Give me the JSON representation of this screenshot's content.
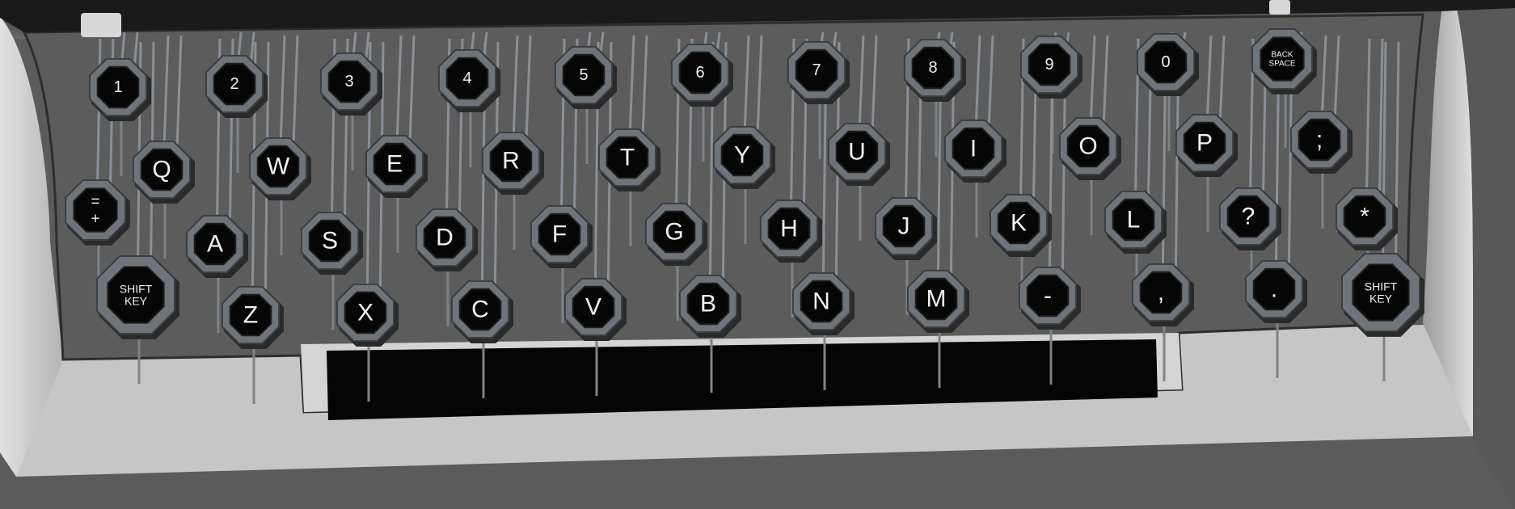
{
  "keyboard": {
    "keys": [
      {
        "id": "1",
        "label": "1"
      },
      {
        "id": "2",
        "label": "2"
      },
      {
        "id": "3",
        "label": "3"
      },
      {
        "id": "4",
        "label": "4"
      },
      {
        "id": "5",
        "label": "5"
      },
      {
        "id": "6",
        "label": "6"
      },
      {
        "id": "7",
        "label": "7"
      },
      {
        "id": "8",
        "label": "8"
      },
      {
        "id": "9",
        "label": "9"
      },
      {
        "id": "0",
        "label": "0"
      },
      {
        "id": "backspace",
        "label": "BACK\nSPACE"
      },
      {
        "id": "q",
        "label": "Q"
      },
      {
        "id": "w",
        "label": "W"
      },
      {
        "id": "e",
        "label": "E"
      },
      {
        "id": "r",
        "label": "R"
      },
      {
        "id": "t",
        "label": "T"
      },
      {
        "id": "y",
        "label": "Y"
      },
      {
        "id": "u",
        "label": "U"
      },
      {
        "id": "i",
        "label": "I"
      },
      {
        "id": "o",
        "label": "O"
      },
      {
        "id": "p",
        "label": "P"
      },
      {
        "id": "semicolon",
        "label": ";"
      },
      {
        "id": "equals-plus",
        "label": "=\n+"
      },
      {
        "id": "a",
        "label": "A"
      },
      {
        "id": "s",
        "label": "S"
      },
      {
        "id": "d",
        "label": "D"
      },
      {
        "id": "f",
        "label": "F"
      },
      {
        "id": "g",
        "label": "G"
      },
      {
        "id": "h",
        "label": "H"
      },
      {
        "id": "j",
        "label": "J"
      },
      {
        "id": "k",
        "label": "K"
      },
      {
        "id": "l",
        "label": "L"
      },
      {
        "id": "question",
        "label": "?"
      },
      {
        "id": "asterisk",
        "label": "*"
      },
      {
        "id": "shift-left",
        "label": "SHIFT\nKEY"
      },
      {
        "id": "z",
        "label": "Z"
      },
      {
        "id": "x",
        "label": "X"
      },
      {
        "id": "c",
        "label": "C"
      },
      {
        "id": "v",
        "label": "V"
      },
      {
        "id": "b",
        "label": "B"
      },
      {
        "id": "n",
        "label": "N"
      },
      {
        "id": "m",
        "label": "M"
      },
      {
        "id": "hyphen",
        "label": "-"
      },
      {
        "id": "comma",
        "label": ","
      },
      {
        "id": "period",
        "label": "."
      },
      {
        "id": "shift-right",
        "label": "SHIFT\nKEY"
      }
    ]
  }
}
